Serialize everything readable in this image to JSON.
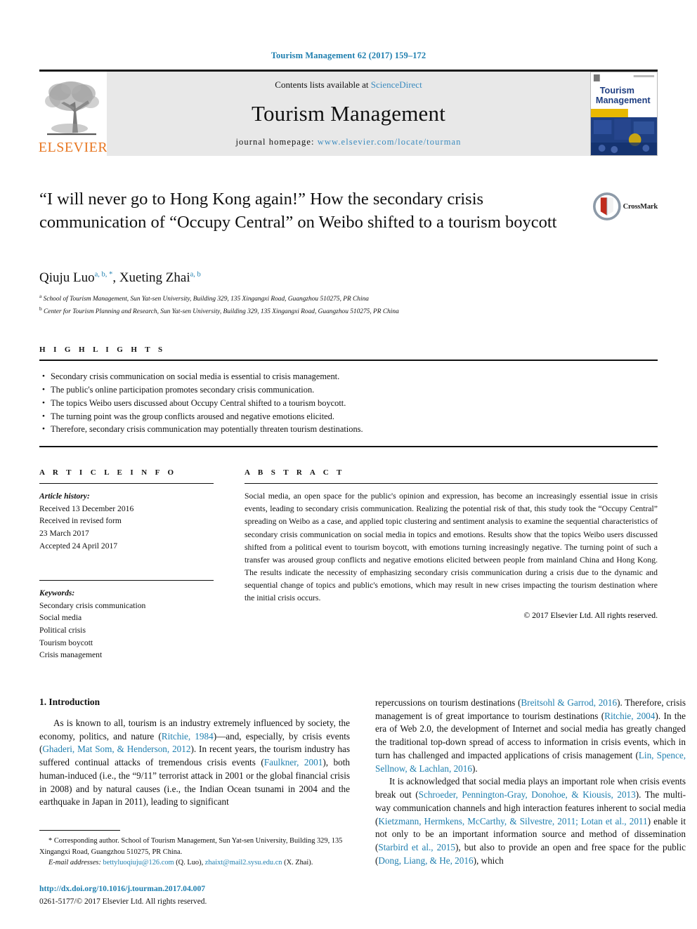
{
  "running_head": "Tourism Management 62 (2017) 159–172",
  "masthead": {
    "publisher_logo_label": "ELSEVIER",
    "contents_prefix": "Contents lists available at ",
    "contents_link": "ScienceDirect",
    "journal_name": "Tourism Management",
    "homepage_prefix": "journal homepage: ",
    "homepage_url": "www.elsevier.com/locate/tourman",
    "cover_title_line1": "Tourism",
    "cover_title_line2": "Management"
  },
  "article": {
    "title": "“I will never go to Hong Kong again!” How the secondary crisis communication of “Occupy Central” on Weibo shifted to a tourism boycott",
    "crossmark_label": "CrossMark",
    "authors": [
      {
        "name": "Qiuju Luo",
        "marks": "a, b, *"
      },
      {
        "name": "Xueting Zhai",
        "marks": "a, b"
      }
    ],
    "affiliations": [
      {
        "mark": "a",
        "text": "School of Tourism Management, Sun Yat-sen University, Building 329, 135 Xingangxi Road, Guangzhou 510275, PR China"
      },
      {
        "mark": "b",
        "text": "Center for Tourism Planning and Research, Sun Yat-sen University, Building 329, 135 Xingangxi Road, Guangzhou 510275, PR China"
      }
    ]
  },
  "highlights": {
    "heading": "H I G H L I G H T S",
    "items": [
      "Secondary crisis communication on social media is essential to crisis management.",
      "The public's online participation promotes secondary crisis communication.",
      "The topics Weibo users discussed about Occupy Central shifted to a tourism boycott.",
      "The turning point was the group conflicts aroused and negative emotions elicited.",
      "Therefore, secondary crisis communication may potentially threaten tourism destinations."
    ]
  },
  "article_info": {
    "heading": "A R T I C L E  I N F O",
    "history_label": "Article history:",
    "history_lines": [
      "Received 13 December 2016",
      "Received in revised form",
      "23 March 2017",
      "Accepted 24 April 2017"
    ],
    "keywords_label": "Keywords:",
    "keywords": [
      "Secondary crisis communication",
      "Social media",
      "Political crisis",
      "Tourism boycott",
      "Crisis management"
    ]
  },
  "abstract": {
    "heading": "A B S T R A C T",
    "text": "Social media, an open space for the public's opinion and expression, has become an increasingly essential issue in crisis events, leading to secondary crisis communication. Realizing the potential risk of that, this study took the “Occupy Central” spreading on Weibo as a case, and applied topic clustering and sentiment analysis to examine the sequential characteristics of secondary crisis communication on social media in topics and emotions. Results show that the topics Weibo users discussed shifted from a political event to tourism boycott, with emotions turning increasingly negative. The turning point of such a transfer was aroused group conflicts and negative emotions elicited between people from mainland China and Hong Kong. The results indicate the necessity of emphasizing secondary crisis communication during a crisis due to the dynamic and sequential change of topics and public's emotions, which may result in new crises impacting the tourism destination where the initial crisis occurs.",
    "copyright": "© 2017 Elsevier Ltd. All rights reserved."
  },
  "introduction": {
    "section_number_title": "1. Introduction",
    "left_paragraph_1_a": "As is known to all, tourism is an industry extremely influenced by society, the economy, politics, and nature (",
    "left_ref_1": "Ritchie, 1984",
    "left_paragraph_1_b": ")—and, especially, by crisis events (",
    "left_ref_2": "Ghaderi, Mat Som, & Henderson, 2012",
    "left_paragraph_1_c": "). In recent years, the tourism industry has suffered continual attacks of tremendous crisis events (",
    "left_ref_3": "Faulkner, 2001",
    "left_paragraph_1_d": "), both human-induced (i.e., the “9/11” terrorist attack in 2001 or the global financial crisis in 2008) and by natural causes (i.e., the Indian Ocean tsunami in 2004 and the earthquake in Japan in 2011), leading to significant",
    "right_paragraph_1_a": "repercussions on tourism destinations (",
    "right_ref_1": "Breitsohl & Garrod, 2016",
    "right_paragraph_1_b": "). Therefore, crisis management is of great importance to tourism destinations (",
    "right_ref_2": "Ritchie, 2004",
    "right_paragraph_1_c": "). In the era of Web 2.0, the development of Internet and social media has greatly changed the traditional top-down spread of access to information in crisis events, which in turn has challenged and impacted applications of crisis management (",
    "right_ref_3": "Lin, Spence, Sellnow, & Lachlan, 2016",
    "right_paragraph_1_d": ").",
    "right_paragraph_2_a": "It is acknowledged that social media plays an important role when crisis events break out (",
    "right_ref_4": "Schroeder, Pennington-Gray, Donohoe, & Kiousis, 2013",
    "right_paragraph_2_b": "). The multi-way communication channels and high interaction features inherent to social media (",
    "right_ref_5": "Kietzmann, Hermkens, McCarthy, & Silvestre, 2011; Lotan et al., 2011",
    "right_paragraph_2_c": ") enable it not only to be an important information source and method of dissemination (",
    "right_ref_6": "Starbird et al., 2015",
    "right_paragraph_2_d": "), but also to provide an open and free space for the public (",
    "right_ref_7": "Dong, Liang, & He, 2016",
    "right_paragraph_2_e": "), which"
  },
  "footnotes": {
    "corresponding_author": "Corresponding author. School of Tourism Management, Sun Yat-sen University, Building 329, 135 Xingangxi Road, Guangzhou 510275, PR China.",
    "email_label": "E-mail addresses:",
    "email_1": "bettyluoqiuju@126.com",
    "email_1_owner": "(Q. Luo),",
    "email_2": "zhaixt@mail2.sysu.edu.cn",
    "email_2_owner": "(X. Zhai)."
  },
  "page_footer": {
    "doi": "http://dx.doi.org/10.1016/j.tourman.2017.04.007",
    "issn_line": "0261-5177/© 2017 Elsevier Ltd. All rights reserved."
  },
  "colors": {
    "link_blue": "#1f7faf",
    "elsevier_orange": "#e87722",
    "masthead_grey": "#e8e8e8",
    "cover_blue": "#1f3f82",
    "cover_gold": "#e8b800",
    "crossmark_red": "#c02b1d"
  }
}
